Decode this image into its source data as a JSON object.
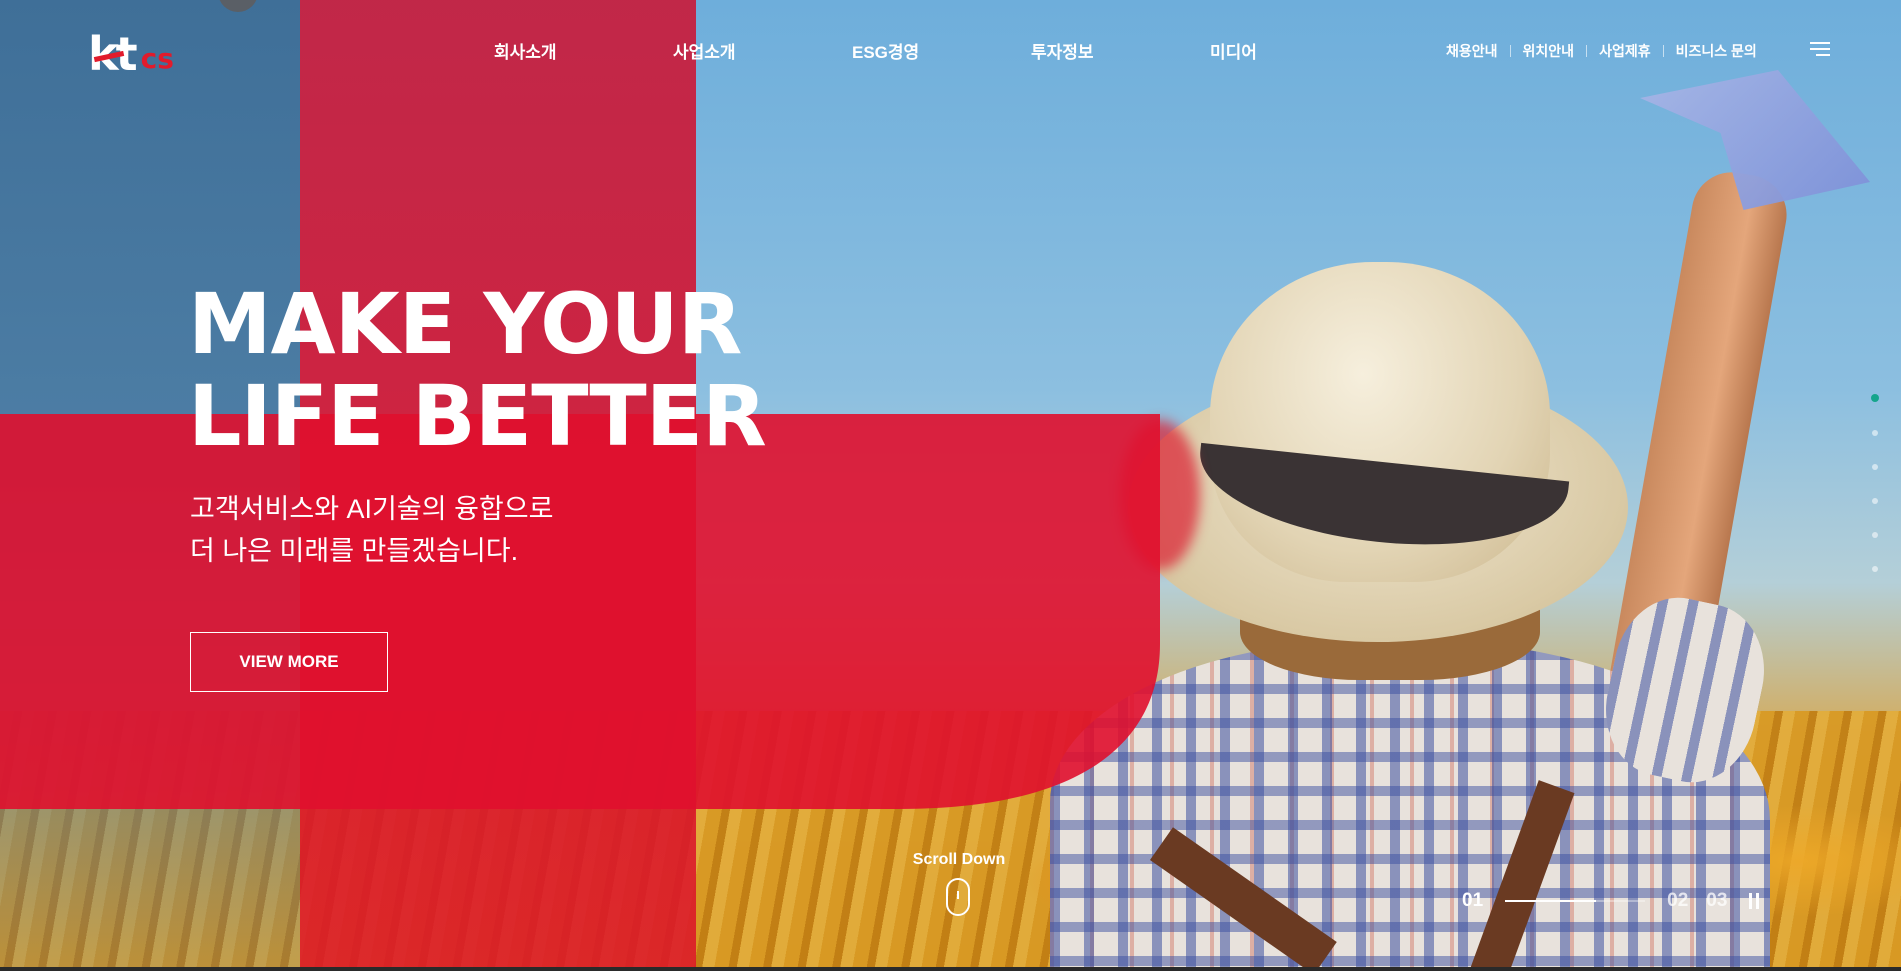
{
  "header": {
    "logo": {
      "kt": "kt",
      "cs": "cs"
    },
    "gnb": [
      "회사소개",
      "사업소개",
      "ESG경영",
      "투자정보",
      "미디어"
    ],
    "util": [
      "채용안내",
      "위치안내",
      "사업제휴",
      "비즈니스 문의"
    ],
    "menu_icon": "hamburger-icon"
  },
  "hero": {
    "title_line1": "MAKE YOUR",
    "title_line2": "LIFE BETTER",
    "sub_line1": "고객서비스와 AI기술의 융합으로",
    "sub_line2": "더 나은 미래를 만들겠습니다.",
    "button": "VIEW MORE"
  },
  "scroll": {
    "label": "Scroll Down",
    "icon": "mouse-icon"
  },
  "pager": {
    "current": "01",
    "next1": "02",
    "next2": "03",
    "progress": 0.65,
    "pause_icon": "pause-icon"
  },
  "section_dots": {
    "count": 6,
    "active_index": 0
  },
  "colors": {
    "brand_red": "#e11b2c",
    "dot_active": "#16a58c",
    "white": "#ffffff"
  }
}
